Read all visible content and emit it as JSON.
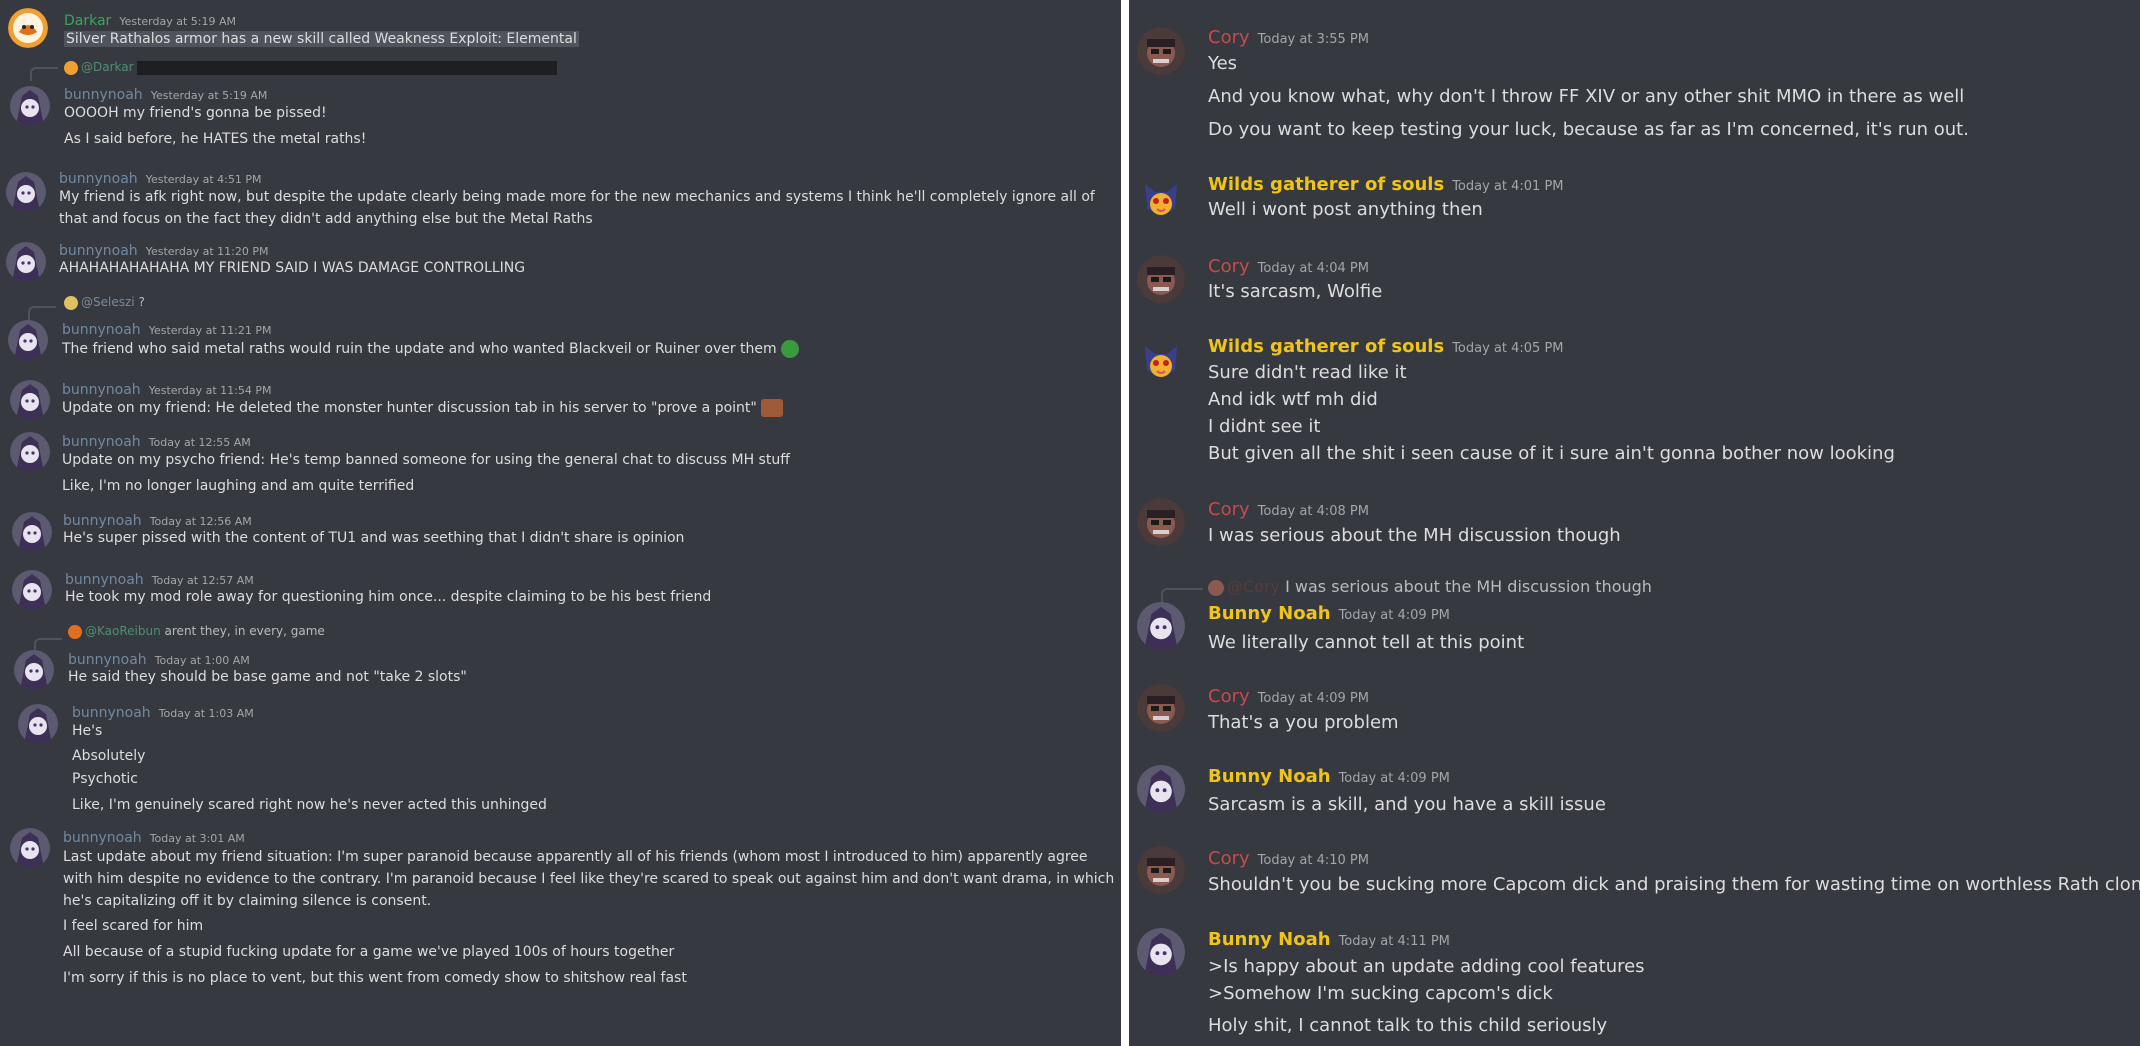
{
  "colors": {
    "background": "#36393f",
    "divider": "#ffffff",
    "text": "#dcddde",
    "timestamp": "#a3a6aa",
    "mention": "#4f8d74",
    "name_darkar": "#3ba55d",
    "name_bunnynoah": "#7289a0",
    "name_cory": "#c84b4b",
    "name_wilds": "#f0c419",
    "name_bunny_noah": "#f0c419"
  },
  "left": {
    "messages": [
      {
        "name": "Darkar",
        "ts": "Yesterday at 5:19 AM",
        "lines": [
          "Silver Rathalos armor has a new skill called Weakness Exploit: Elemental"
        ]
      },
      {
        "reply_to": "@Darkar",
        "name": "bunnynoah",
        "ts": "Yesterday at 5:19 AM",
        "lines": [
          "OOOOH my friend's gonna be pissed!",
          "As I said before, he HATES the metal raths!"
        ]
      },
      {
        "name": "bunnynoah",
        "ts": "Yesterday at 4:51 PM",
        "lines": [
          "My friend is afk right now, but despite the update clearly being made more for the new mechanics and systems I think he'll completely ignore all of that and focus on the fact they didn't add anything else but the Metal Raths"
        ]
      },
      {
        "name": "bunnynoah",
        "ts": "Yesterday at 11:20 PM",
        "lines": [
          "AHAHAHAHAHAHA MY FRIEND SAID I WAS DAMAGE CONTROLLING"
        ]
      },
      {
        "reply_to": "@Seleszi",
        "reply_text": "?",
        "name": "bunnynoah",
        "ts": "Yesterday at 11:21 PM",
        "lines": [
          "The friend who said metal raths would ruin the update and who wanted Blackveil or Ruiner over them"
        ]
      },
      {
        "name": "bunnynoah",
        "ts": "Yesterday at 11:54 PM",
        "lines": [
          "Update on my  friend: He deleted the monster hunter discussion tab in his server to \"prove a point\""
        ]
      },
      {
        "name": "bunnynoah",
        "ts": "Today at 12:55 AM",
        "lines": [
          "Update on my psycho friend: He's temp banned someone for using the general chat to discuss MH stuff",
          "Like, I'm no longer laughing and am quite terrified"
        ]
      },
      {
        "name": "bunnynoah",
        "ts": "Today at 12:56 AM",
        "lines": [
          "He's super pissed with the content of TU1 and was seething that I didn't share is opinion"
        ]
      },
      {
        "name": "bunnynoah",
        "ts": "Today at 12:57 AM",
        "lines": [
          "He took my mod role away for questioning him once... despite claiming to be his best friend"
        ]
      },
      {
        "reply_to": "@KaoReibun",
        "reply_text": "arent they, in every, game",
        "name": "bunnynoah",
        "ts": "Today at 1:00 AM",
        "lines": [
          "He said they should be base game and not \"take 2 slots\""
        ]
      },
      {
        "name": "bunnynoah",
        "ts": "Today at 1:03 AM",
        "lines": [
          "He's",
          "Absolutely",
          "Psychotic",
          "Like, I'm genuinely scared right now he's never acted this unhinged"
        ]
      },
      {
        "name": "bunnynoah",
        "ts": "Today at 3:01 AM",
        "lines": [
          "Last update about my friend situation: I'm super paranoid because apparently all of his friends (whom most I introduced to him) apparently agree with him despite no evidence to the contrary. I'm paranoid because I feel like they're scared to speak out against him and don't want drama, in which he's capitalizing off it by claiming silence is consent.",
          "I feel scared for him",
          "All because of a stupid fucking update for a game we've played 100s of hours together",
          "I'm sorry if this is no place to vent, but this went from comedy show to shitshow real fast"
        ]
      }
    ]
  },
  "right": {
    "messages": [
      {
        "name": "Cory",
        "ts": "Today at 3:55 PM",
        "lines": [
          "Yes",
          "And you know what, why don't I throw FF XIV or any other shit MMO in there as well",
          "Do you want to keep testing your luck, because as far as I'm concerned, it's run out."
        ]
      },
      {
        "name": "Wilds gatherer of souls",
        "ts": "Today at 4:01 PM",
        "lines": [
          "Well i wont post anything then"
        ]
      },
      {
        "name": "Cory",
        "ts": "Today at 4:04 PM",
        "lines": [
          "It's sarcasm, Wolfie"
        ]
      },
      {
        "name": "Wilds gatherer of souls",
        "ts": "Today at 4:05 PM",
        "lines": [
          "Sure didn't read like it",
          "And idk wtf mh did",
          "I didnt see it",
          "But given all the shit i seen cause of it i sure ain't gonna bother now looking"
        ]
      },
      {
        "name": "Cory",
        "ts": "Today at 4:08 PM",
        "lines": [
          "I was serious about the MH discussion though"
        ]
      },
      {
        "reply_to": "@Cory",
        "reply_text": "I was serious about the MH discussion though",
        "name": "Bunny Noah",
        "ts": "Today at 4:09 PM",
        "lines": [
          "We literally cannot tell at this point"
        ]
      },
      {
        "name": "Cory",
        "ts": "Today at 4:09 PM",
        "lines": [
          "That's a you problem"
        ]
      },
      {
        "name": "Bunny Noah",
        "ts": "Today at 4:09 PM",
        "lines": [
          "Sarcasm is a skill, and you have a skill issue"
        ]
      },
      {
        "name": "Cory",
        "ts": "Today at 4:10 PM",
        "lines": [
          "Shouldn't you be sucking more Capcom dick and praising them for wasting time on worthless Rath clones?"
        ]
      },
      {
        "name": "Bunny Noah",
        "ts": "Today at 4:11 PM",
        "lines": [
          ">Is happy about an update adding cool features",
          ">Somehow I'm sucking capcom's dick",
          "Holy shit, I cannot talk to this child seriously"
        ]
      }
    ]
  }
}
